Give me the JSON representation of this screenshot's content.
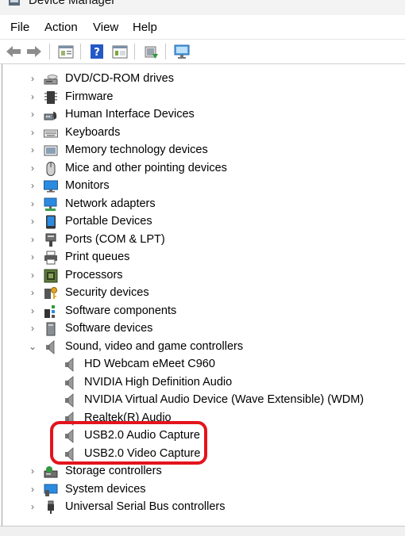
{
  "window": {
    "title": "Device Manager"
  },
  "menu": [
    "File",
    "Action",
    "View",
    "Help"
  ],
  "tree": {
    "categories_top": [
      {
        "label": "DVD/CD-ROM drives",
        "icon": "dvd-drive-icon"
      },
      {
        "label": "Firmware",
        "icon": "firmware-chip-icon"
      },
      {
        "label": "Human Interface Devices",
        "icon": "hid-icon"
      },
      {
        "label": "Keyboards",
        "icon": "keyboard-icon"
      },
      {
        "label": "Memory technology devices",
        "icon": "memory-card-icon"
      },
      {
        "label": "Mice and other pointing devices",
        "icon": "mouse-icon"
      },
      {
        "label": "Monitors",
        "icon": "monitor-icon"
      },
      {
        "label": "Network adapters",
        "icon": "network-adapter-icon"
      },
      {
        "label": "Portable Devices",
        "icon": "portable-device-icon"
      },
      {
        "label": "Ports (COM & LPT)",
        "icon": "port-icon"
      },
      {
        "label": "Print queues",
        "icon": "printer-icon"
      },
      {
        "label": "Processors",
        "icon": "processor-icon"
      },
      {
        "label": "Security devices",
        "icon": "security-key-icon"
      },
      {
        "label": "Software components",
        "icon": "software-components-icon"
      },
      {
        "label": "Software devices",
        "icon": "software-device-icon"
      }
    ],
    "expanded": {
      "label": "Sound, video and game controllers",
      "icon": "speaker-icon",
      "children": [
        "HD Webcam eMeet C960",
        "NVIDIA High Definition Audio",
        "NVIDIA Virtual Audio Device (Wave Extensible) (WDM)",
        "Realtek(R) Audio",
        "USB2.0 Audio Capture",
        "USB2.0 Video Capture"
      ]
    },
    "categories_bottom": [
      {
        "label": "Storage controllers",
        "icon": "storage-controller-icon"
      },
      {
        "label": "System devices",
        "icon": "system-devices-icon"
      },
      {
        "label": "Universal Serial Bus controllers",
        "icon": "usb-icon"
      }
    ]
  },
  "colors": {
    "highlight": "#e3141d"
  }
}
